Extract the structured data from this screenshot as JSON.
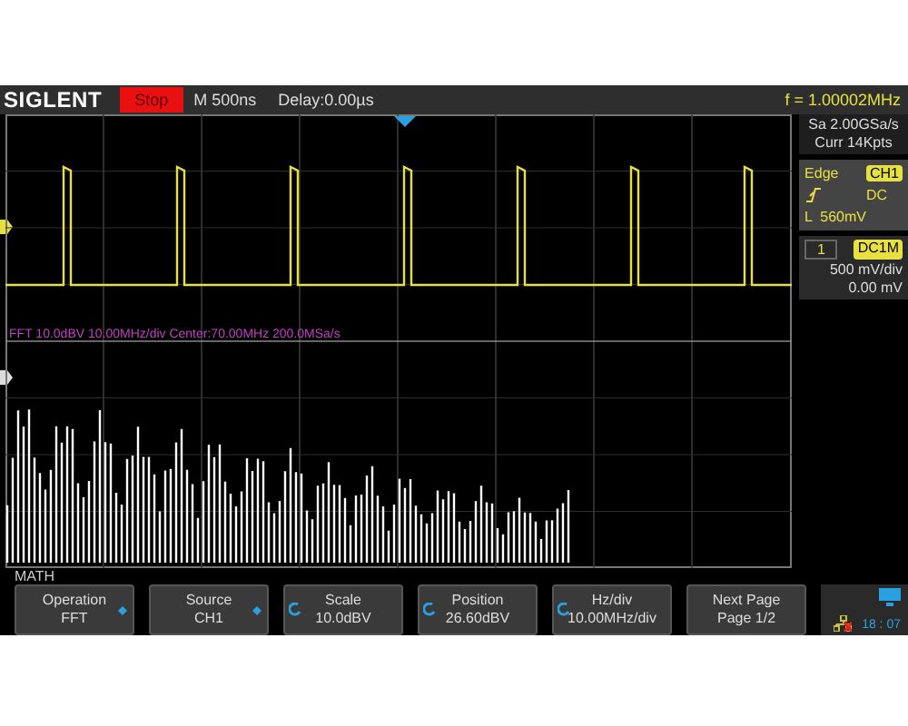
{
  "header": {
    "logo": "SIGLENT",
    "run_state": "Stop",
    "timebase": "M 500ns",
    "delay": "Delay:0.00µs",
    "frequency": "f = 1.00002MHz"
  },
  "acquisition": {
    "sample_rate": "Sa 2.00GSa/s",
    "memory": "Curr 14Kpts"
  },
  "trigger": {
    "type": "Edge",
    "source": "CH1",
    "coupling": "DC",
    "level": "L  560mV"
  },
  "channel": {
    "number": "1",
    "coupling": "DC1M",
    "scale": "500 mV/div",
    "offset": "0.00 mV"
  },
  "math_info": "FFT  10.0dBV  10.00MHz/div  Center:70.00MHz  200.0MSa/s",
  "menu": {
    "title": "MATH",
    "buttons": [
      {
        "label": "Operation",
        "value": "FFT",
        "kind": "select"
      },
      {
        "label": "Source",
        "value": "CH1",
        "kind": "select"
      },
      {
        "label": "Scale",
        "value": "10.0dBV",
        "kind": "knob"
      },
      {
        "label": "Position",
        "value": "26.60dBV",
        "kind": "knob"
      },
      {
        "label": "Hz/div",
        "value": "10.00MHz/div",
        "kind": "knob"
      },
      {
        "label": "Next Page",
        "value": "Page 1/2",
        "kind": "plain"
      }
    ]
  },
  "status": {
    "time": "18 : 07"
  }
}
